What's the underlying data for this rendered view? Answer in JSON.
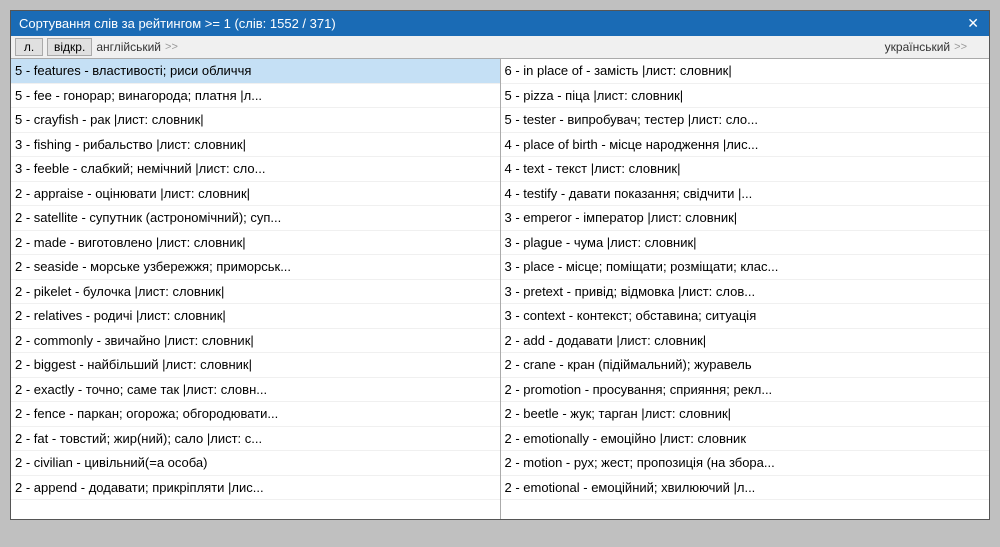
{
  "window": {
    "title": "Сортування слів за рейтингом >= 1   (слів: 1552 / 371)",
    "close_label": "✕"
  },
  "toolbar": {
    "col1_label": "л.",
    "col2_label": "відкр.",
    "col3_label": "англійський",
    "col3_arrow": ">>",
    "col4_label": "український",
    "col4_arrow": ">>"
  },
  "left_pane": {
    "items": [
      "5 - features - властивості; риси обличчя",
      "5 - fee - гонорар; винагорода; платня   |л...",
      "5 - crayfish - рак    |лист: словник|",
      "3 - fishing - рибальство    |лист: словник|",
      "3 - feeble - слабкий; немічний    |лист: сло...",
      "2 - appraise - оцінювати    |лист: словник|",
      "2 - satellite - супутник (астрономічний); суп...",
      "2 - made - виготовлено    |лист: словник|",
      "2 - seaside - морське узбережжя; приморськ...",
      "2 - pikelet - булочка    |лист: словник|",
      "2 - relatives - родичі    |лист: словник|",
      "2 - commonly - звичайно    |лист: словник|",
      "2 - biggest - найбільший    |лист: словник|",
      "2 - exactly - точно; саме так    |лист: словн...",
      "2 - fence - паркан; огорожа; обгородювати...",
      "2 - fat - товстий; жир(ний); сало    |лист: с...",
      "2 - civilian - цивільний(=а особа)",
      "2 - append - додавати; прикріпляти    |лис..."
    ]
  },
  "right_pane": {
    "items": [
      "6 - in place of - замість    |лист: словник|",
      "5 - pizza - піца    |лист: словник|",
      "5 - tester - випробувач; тестер    |лист: сло...",
      "4 - place of birth - місце народження    |лис...",
      "4 - text - текст    |лист: словник|",
      "4 - testify - давати показання; свідчити    |...",
      "3 - emperor - імператор    |лист: словник|",
      "3 - plague - чума    |лист: словник|",
      "3 - place - місце; поміщати; розміщати; клас...",
      "3 - pretext - привід; відмовка    |лист: слов...",
      "3 - context - контекст; обставина; ситуація",
      "2 - add - додавати    |лист: словник|",
      "2 - crane - кран (підіймальний); журавель",
      "2 - promotion - просування; сприяння; рекл...",
      "2 - beetle - жук; тарган    |лист: словник|",
      "2 - emotionally - емоційно    |лист: словник",
      "2 - motion - рух; жест; пропозиція (на збора...",
      "2 - emotional - емоційний; хвилюючий    |л..."
    ]
  }
}
